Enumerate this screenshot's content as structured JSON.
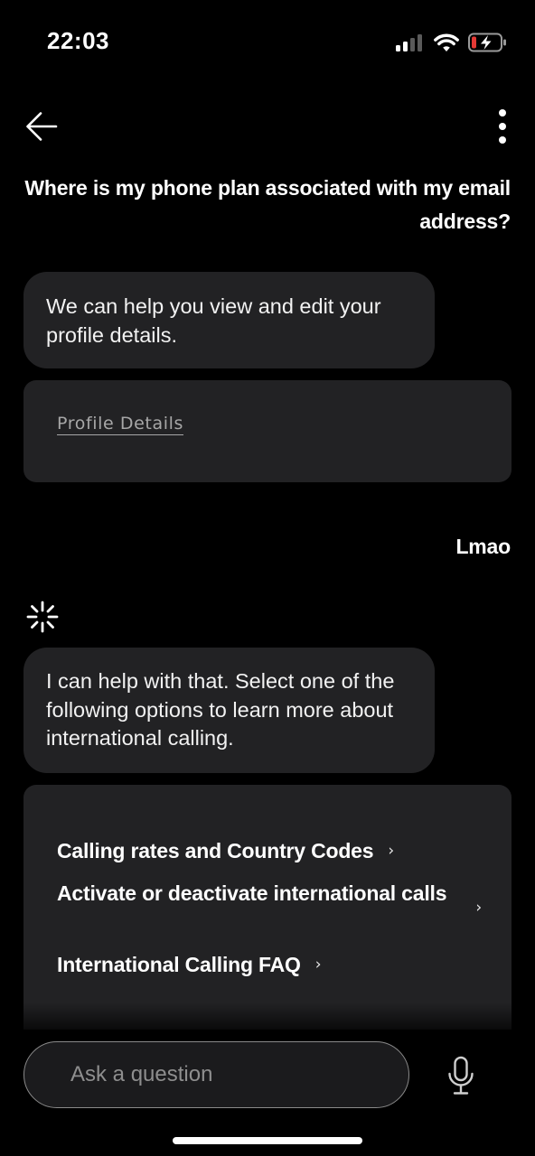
{
  "status_bar": {
    "time": "22:03",
    "icons": [
      "signal-icon",
      "wifi-icon",
      "battery-charging-icon"
    ],
    "battery_accent": "#e53935"
  },
  "nav": {
    "back_icon": "arrow-left-icon",
    "more_icon": "more-vertical-icon"
  },
  "messages": {
    "user_1": "Where is my phone plan associated with my email address?",
    "bot_1": "We can help you view and edit your profile details.",
    "bot_1_link": "Profile Details",
    "user_2": "Lmao",
    "bot_2": "I can help with that. Select one of the following options to learn more about international calling.",
    "bot_2_options": [
      {
        "label": "Calling rates and Country Codes",
        "chevron": "›"
      },
      {
        "label": "Activate or deactivate international calls",
        "chevron": "›"
      },
      {
        "label": "International Calling FAQ",
        "chevron": "›"
      }
    ]
  },
  "composer": {
    "placeholder": "Ask a question",
    "mic_icon": "microphone-icon"
  },
  "colors": {
    "background": "#000000",
    "bubble": "#222224",
    "text": "#ffffff",
    "link_muted": "#a7a7a7"
  }
}
